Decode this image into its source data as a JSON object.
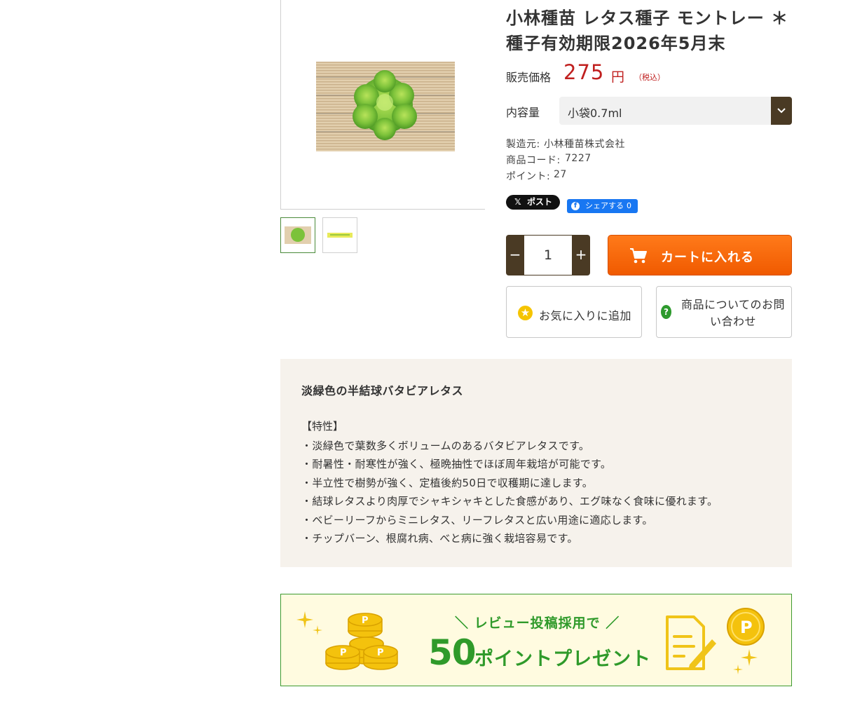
{
  "product": {
    "title": "小林種苗 レタス種子 モントレー ＊種子有効期限2026年5月末",
    "price_label": "販売価格",
    "price": "275",
    "price_unit": "円",
    "tax_note": "（税込）",
    "quantity_label": "内容量",
    "selected_option": "小袋0.7ml",
    "maker_label": "製造元:",
    "maker": "小林種苗株式会社",
    "code_label": "商品コード:",
    "code": "7227",
    "point_label": "ポイント:",
    "point": "27"
  },
  "social": {
    "x_post": "ポスト",
    "x_logo": "𝕏",
    "fb_logo": "f",
    "fb_share": "シェアする",
    "fb_count": "0"
  },
  "cart": {
    "minus": "−",
    "qty": "1",
    "plus": "+",
    "add_to_cart": "カートに入れる",
    "favorite": "お気に入りに追加",
    "inquiry": "商品についてのお問い合わせ",
    "fav_icon": "★",
    "inquiry_icon": "?"
  },
  "description": {
    "heading": "淡緑色の半結球バタビアレタス",
    "section": "【特性】",
    "items": [
      "淡緑色で葉数多くボリュームのあるバタビアレタスです。",
      "耐暑性・耐寒性が強く、極晩抽性でほぼ周年栽培が可能です。",
      "半立性で樹勢が強く、定植後約50日で収穫期に達します。",
      "結球レタスより肉厚でシャキシャキとした食感があり、エグ味なく食味に優れます。",
      "ベビーリーフからミニレタス、リーフレタスと広い用途に適応します。",
      "チップバーン、根腐れ病、べと病に強く栽培容易です。"
    ]
  },
  "banner": {
    "line1": "＼ レビュー投稿採用で ／",
    "number": "50",
    "line2": "ポイントプレゼント"
  },
  "colors": {
    "price": "#c0201f",
    "accent_brown": "#4a3a24",
    "cart_orange": "#f86400",
    "banner_green": "#2f9a2a"
  }
}
